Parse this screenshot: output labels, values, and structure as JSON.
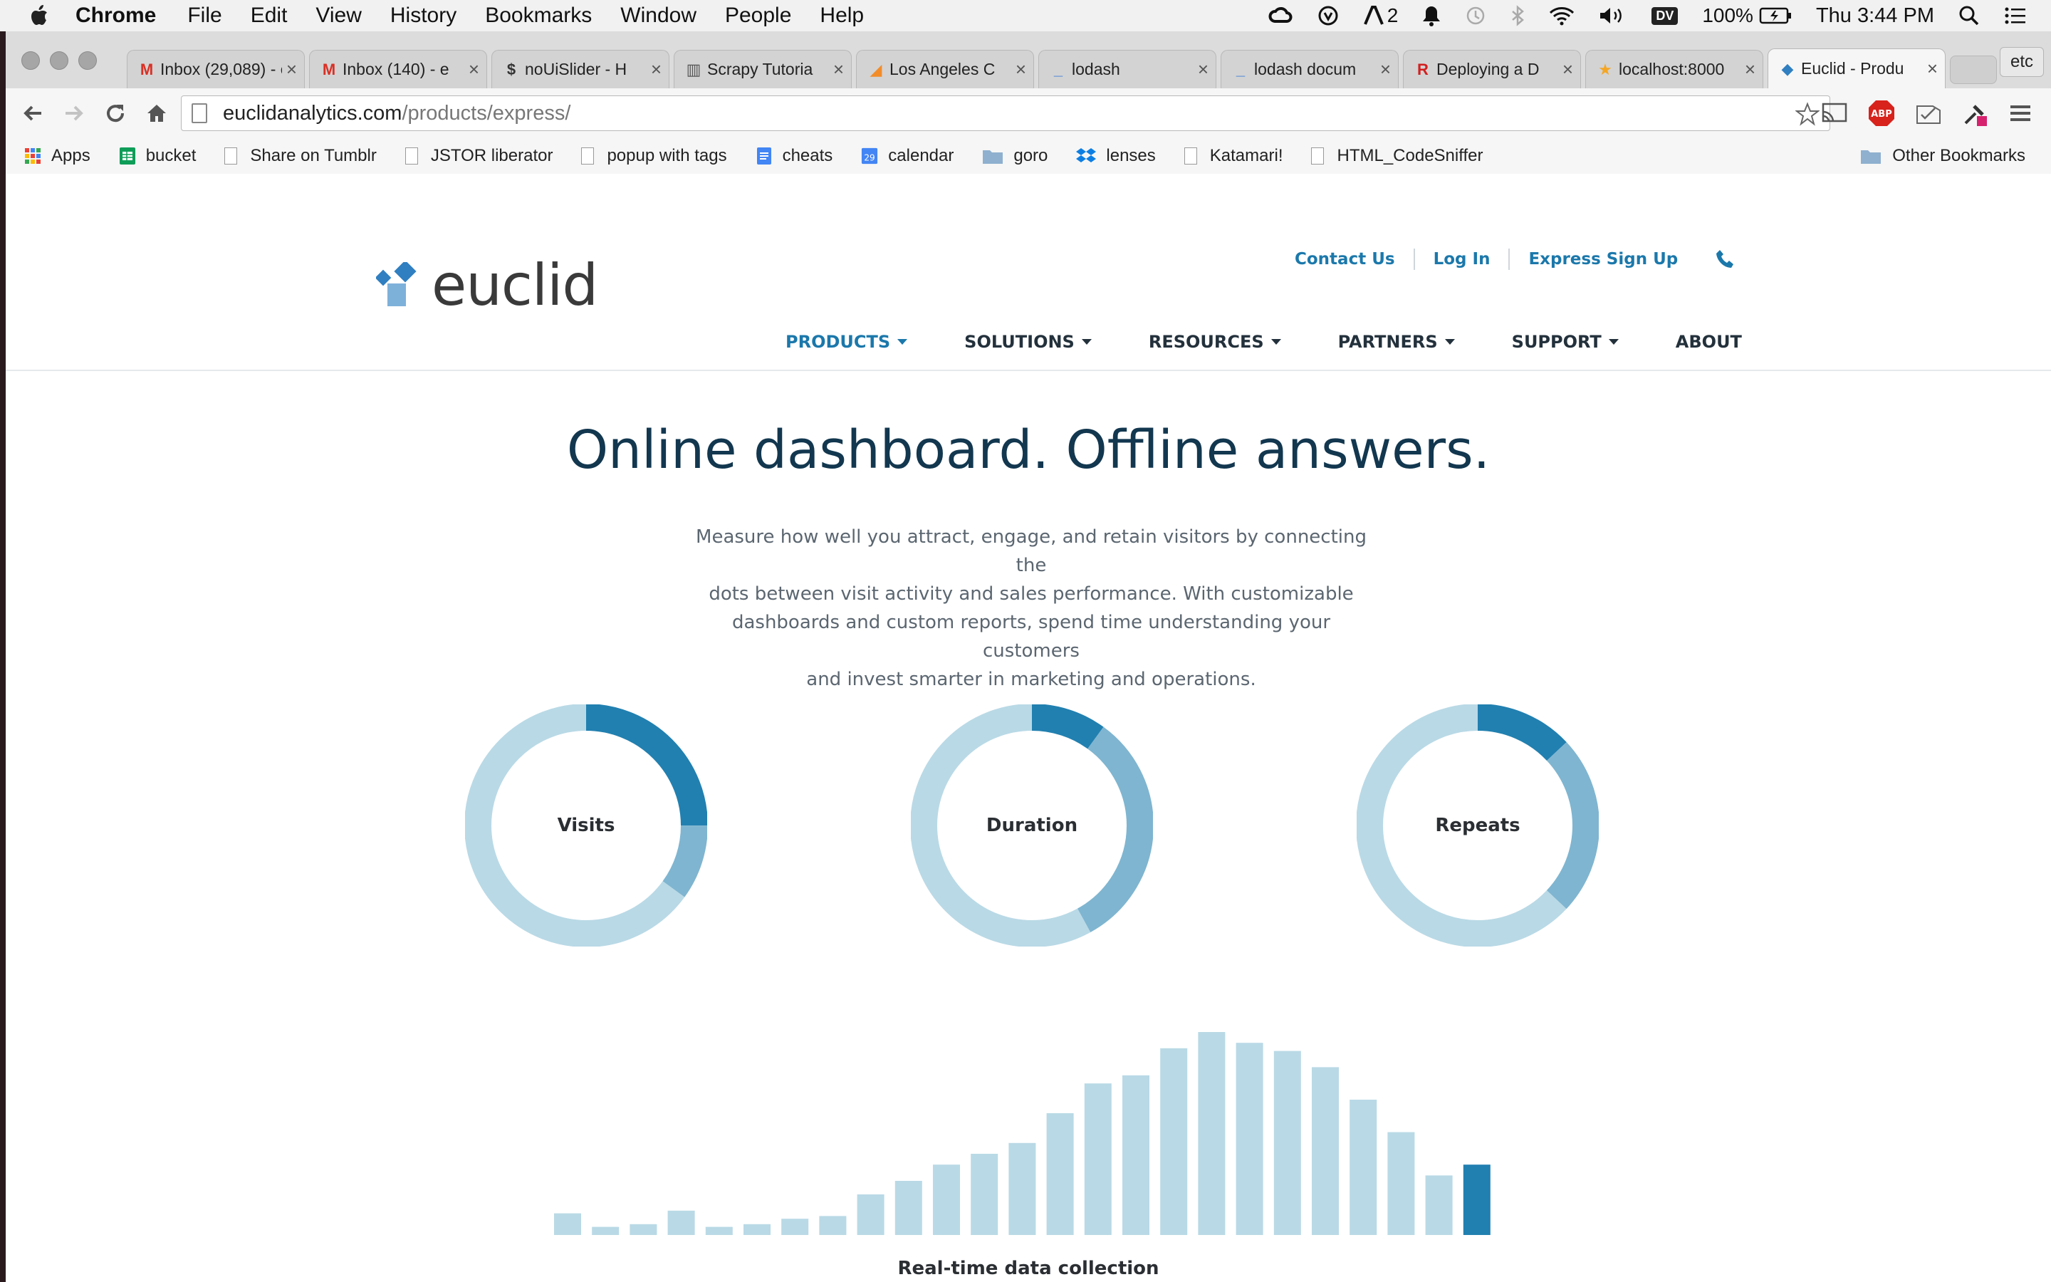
{
  "menubar": {
    "app": "Chrome",
    "items": [
      "File",
      "Edit",
      "View",
      "History",
      "Bookmarks",
      "Window",
      "People",
      "Help"
    ],
    "notif_count": "2",
    "user_badge": "DV",
    "battery": "100%",
    "clock": "Thu 3:44 PM"
  },
  "tabs": [
    {
      "title": "Inbox (29,089) - e",
      "icon": "gmail-icon",
      "active": false
    },
    {
      "title": "Inbox (140) - e",
      "icon": "gmail-icon",
      "active": false
    },
    {
      "title": "noUiSlider - H",
      "icon": "dollar-icon",
      "active": false
    },
    {
      "title": "Scrapy Tutoria",
      "icon": "book-icon",
      "active": false
    },
    {
      "title": "Los Angeles C",
      "icon": "bird-icon",
      "active": false
    },
    {
      "title": "lodash",
      "icon": "underscore-icon",
      "active": false
    },
    {
      "title": "lodash docum",
      "icon": "underscore-icon",
      "active": false
    },
    {
      "title": "Deploying a D",
      "icon": "rp-icon",
      "active": false
    },
    {
      "title": "localhost:8000",
      "icon": "star-icon",
      "active": false
    },
    {
      "title": "Euclid - Produ",
      "icon": "euclid-icon",
      "active": true
    }
  ],
  "etc_label": "etc",
  "address": {
    "domain": "euclidanalytics.com",
    "path": "/products/express/"
  },
  "bookmarks": [
    {
      "label": "Apps",
      "icon": "apps-grid-icon"
    },
    {
      "label": "bucket",
      "icon": "sheet-icon"
    },
    {
      "label": "Share on Tumblr",
      "icon": "page-icon"
    },
    {
      "label": "JSTOR liberator",
      "icon": "page-icon"
    },
    {
      "label": "popup with tags",
      "icon": "page-icon"
    },
    {
      "label": "cheats",
      "icon": "doc-icon"
    },
    {
      "label": "calendar",
      "icon": "calendar-icon"
    },
    {
      "label": "goro",
      "icon": "folder-icon"
    },
    {
      "label": "lenses",
      "icon": "dropbox-icon"
    },
    {
      "label": "Katamari!",
      "icon": "page-icon"
    },
    {
      "label": "HTML_CodeSniffer",
      "icon": "page-icon"
    }
  ],
  "calendar_day": "29",
  "other_bookmarks": "Other Bookmarks",
  "site": {
    "logo_text": "euclid",
    "utility": {
      "contact": "Contact Us",
      "login": "Log In",
      "signup": "Express Sign Up"
    },
    "nav": [
      "PRODUCTS",
      "SOLUTIONS",
      "RESOURCES",
      "PARTNERS",
      "SUPPORT",
      "ABOUT"
    ],
    "headline": "Online dashboard. Offline answers.",
    "intro_lines": [
      "Measure how well you attract, engage, and retain visitors by connecting the",
      "dots between visit activity and sales performance. With customizable",
      "dashboards and custom reports, spend time understanding your customers",
      "and invest smarter in marketing and operations."
    ],
    "donuts": [
      {
        "label": "Visits",
        "segments": [
          0.25,
          0.1,
          0.65
        ]
      },
      {
        "label": "Duration",
        "segments": [
          0.1,
          0.32,
          0.58
        ]
      },
      {
        "label": "Repeats",
        "segments": [
          0.13,
          0.24,
          0.63
        ]
      }
    ],
    "bars": [
      8,
      3,
      4,
      9,
      3,
      4,
      6,
      7,
      15,
      20,
      26,
      30,
      34,
      45,
      56,
      59,
      69,
      75,
      71,
      68,
      62,
      50,
      38,
      22,
      26
    ],
    "highlight_last": true,
    "bar_caption": "Real-time data collection"
  },
  "colors": {
    "dark": "#2180b0",
    "mid": "#7fb5d0",
    "light": "#b9d9e6",
    "brand": "#1b78ab"
  }
}
